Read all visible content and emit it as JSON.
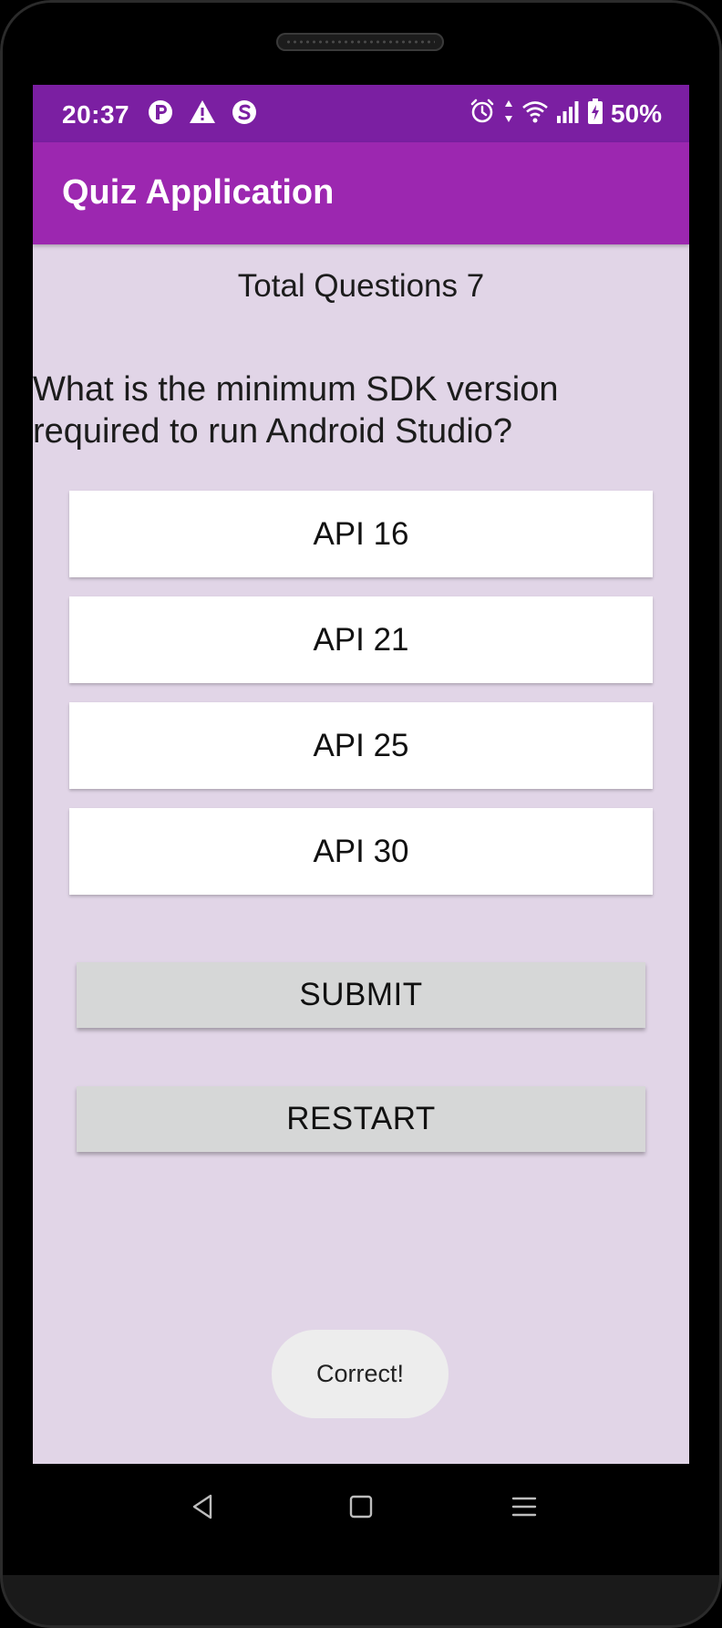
{
  "status_bar": {
    "time": "20:37",
    "left_icons": [
      "notification-p-icon",
      "warning-icon",
      "s-app-icon"
    ],
    "right_icons": [
      "alarm-icon",
      "data-arrows-icon",
      "wifi-icon",
      "signal-icon",
      "battery-charging-icon"
    ],
    "battery": "50%"
  },
  "app_bar": {
    "title": "Quiz Application"
  },
  "quiz": {
    "total_questions": "Total Questions 7",
    "question": "What is the minimum SDK version required to run Android Studio?",
    "options": [
      "API 16",
      "API 21",
      "API 25",
      "API 30"
    ]
  },
  "actions": {
    "submit_label": "SUBMIT",
    "restart_label": "RESTART"
  },
  "toast": {
    "text": "Correct!"
  },
  "nav_bar": {
    "buttons": [
      "back-icon",
      "home-icon",
      "recents-icon"
    ]
  },
  "colors": {
    "status_bar": "#7b1fa2",
    "app_bar": "#9c27b0",
    "background": "#e1d5e7",
    "option_bg": "#ffffff",
    "button_bg": "#d6d7d7",
    "toast_bg": "#ededed"
  }
}
